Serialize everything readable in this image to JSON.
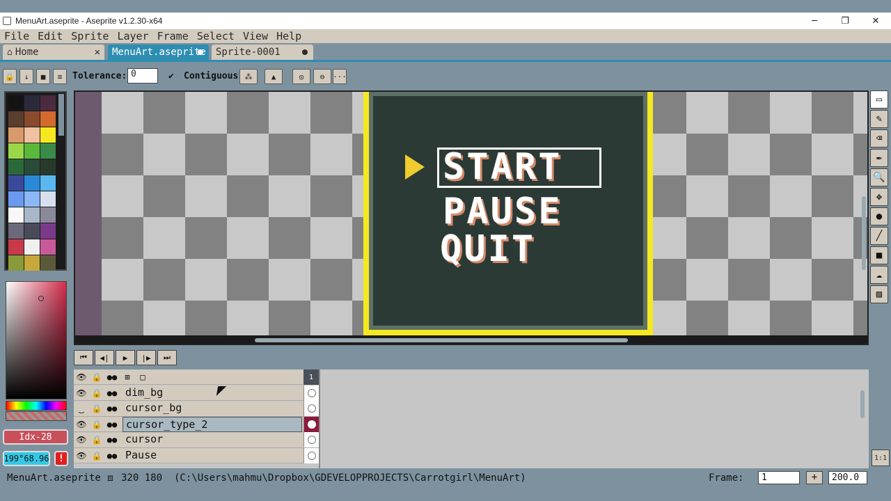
{
  "window": {
    "title": "MenuArt.aseprite - Aseprite v1.2.30-x64",
    "minimize": "─",
    "restore": "❐",
    "close": "✕"
  },
  "menu": [
    "File",
    "Edit",
    "Sprite",
    "Layer",
    "Frame",
    "Select",
    "View",
    "Help"
  ],
  "tabs": {
    "home": "Home",
    "home_icon": "home-icon",
    "home_close": "✕",
    "menuart": "MenuArt.aseprite",
    "sprite": "Sprite-0001"
  },
  "context": {
    "tolerance_label": "Tolerance:",
    "tolerance_value": "0",
    "contiguous_check": "✔",
    "contiguous_label": "Contiguous",
    "more": "···"
  },
  "palette": {
    "colors": [
      "#141414",
      "#2a2a3a",
      "#4b2b3f",
      "#5a3e2e",
      "#8a4a2e",
      "#d46a2e",
      "#d89a6a",
      "#f0c0a0",
      "#f5e820",
      "#9ad84a",
      "#5ab83a",
      "#3a8a4a",
      "#2a6a3a",
      "#2a4a3a",
      "#2a3a2a",
      "#3a4a9a",
      "#2a8ad8",
      "#5ab8f0",
      "#6a9af0",
      "#8ab8f8",
      "#d8e0f0",
      "#f8f8f8",
      "#a8b8c8",
      "#8a8a9a",
      "#6a6a7a",
      "#4a4a5a",
      "#7a3a8a",
      "#c83a4a",
      "#f0f0f0",
      "#c85a9a",
      "#8a9a3a",
      "#c8a83a",
      "#5a5a3a"
    ]
  },
  "color_status": {
    "index": "Idx-28",
    "hex": "199°68.96",
    "warning": "!"
  },
  "sprite_menu": {
    "start": "START",
    "pause": "PAUSE",
    "quit": "QUIT"
  },
  "tools": [
    "▭",
    "✎",
    "⌫",
    "✒",
    "🔍",
    "✥",
    "●",
    "╱",
    "■",
    "☁",
    "▨"
  ],
  "playback": [
    "⏮",
    "◀|",
    "▶",
    "|▶",
    "⏭"
  ],
  "timeline": {
    "frame_number": "1",
    "layers": [
      {
        "name": "dim_bg",
        "visible": true
      },
      {
        "name": "cursor_bg",
        "visible": false
      },
      {
        "name": "cursor_type_2",
        "visible": true,
        "selected": true
      },
      {
        "name": "cursor",
        "visible": true
      },
      {
        "name": "Pause",
        "visible": true
      }
    ]
  },
  "status": {
    "filename": "MenuArt.aseprite",
    "size": "320 180",
    "path": "(C:\\Users\\mahmu\\Dropbox\\GDEVELOPPROJECTS\\Carrotgirl\\MenuArt)",
    "frame_label": "Frame:",
    "frame_value": "1",
    "add": "+",
    "zoom": "200.0"
  },
  "zoom_fit": "1:1"
}
